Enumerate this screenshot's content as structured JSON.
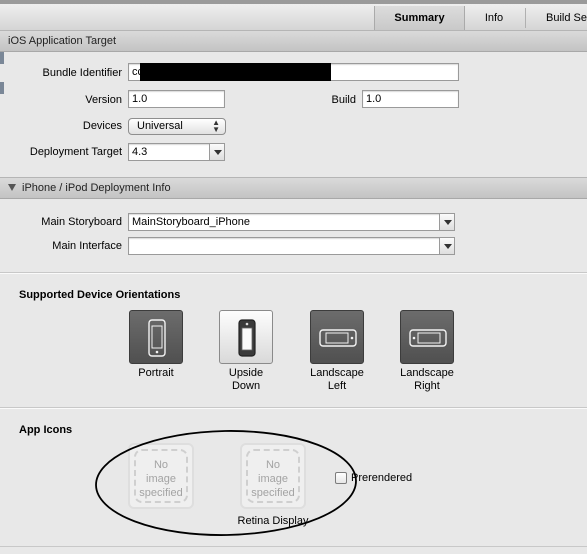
{
  "tabs": [
    {
      "label": "Summary",
      "selected": true
    },
    {
      "label": "Info",
      "selected": false
    },
    {
      "label": "Build Se",
      "selected": false
    }
  ],
  "ios_target": {
    "header": "iOS Application Target",
    "bundle_identifier_label": "Bundle Identifier",
    "bundle_identifier_value": "cc",
    "version_label": "Version",
    "version_value": "1.0",
    "build_label": "Build",
    "build_value": "1.0",
    "devices_label": "Devices",
    "devices_value": "Universal",
    "deployment_target_label": "Deployment Target",
    "deployment_target_value": "4.3"
  },
  "deployment_info": {
    "header": "iPhone / iPod Deployment Info",
    "main_storyboard_label": "Main Storyboard",
    "main_storyboard_value": "MainStoryboard_iPhone",
    "main_interface_label": "Main Interface",
    "main_interface_value": ""
  },
  "orientations": {
    "title": "Supported Device Orientations",
    "items": [
      {
        "line1": "Portrait",
        "line2": "",
        "selected": true,
        "icon": "portrait-phone-icon"
      },
      {
        "line1": "Upside",
        "line2": "Down",
        "selected": false,
        "icon": "upside-down-phone-icon"
      },
      {
        "line1": "Landscape",
        "line2": "Left",
        "selected": true,
        "icon": "landscape-left-phone-icon"
      },
      {
        "line1": "Landscape",
        "line2": "Right",
        "selected": true,
        "icon": "landscape-right-phone-icon"
      }
    ]
  },
  "app_icons": {
    "title": "App Icons",
    "placeholder_line1": "No",
    "placeholder_line2": "image",
    "placeholder_line3": "specified",
    "retina_label": "Retina Display",
    "prerendered_label": "Prerendered",
    "prerendered_checked": false
  },
  "colors": {
    "panel_bg": "#e8e8e8",
    "selected_toggle": "#5a5a5a",
    "annotation_ellipse": "#000000"
  }
}
